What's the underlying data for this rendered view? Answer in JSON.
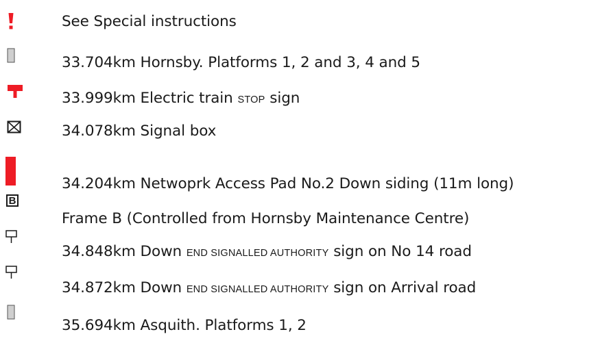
{
  "entries": [
    {
      "icon": "exclamation-icon",
      "text": "See Special instructions"
    },
    {
      "icon": "platform-icon",
      "text": "33.704km Hornsby. Platforms 1, 2 and 3, 4 and 5"
    },
    {
      "icon": "stop-sign-icon",
      "text_before": "33.999km Electric train ",
      "small_caps": "STOP",
      "text_after": " sign"
    },
    {
      "icon": "signal-box-icon",
      "text": "34.078km Signal box"
    },
    {
      "icon": "access-pad-icon",
      "text": "34.204km Netwoprk Access Pad No.2 Down siding (11m long)"
    },
    {
      "icon": "frame-b-icon",
      "icon_letter": "B",
      "text": "Frame B (Controlled from Hornsby Maintenance Centre)"
    },
    {
      "icon": "end-authority-sign-icon",
      "text_before": "34.848km Down ",
      "small_caps": "END SIGNALLED AUTHORITY",
      "text_after": " sign on No 14 road"
    },
    {
      "icon": "end-authority-sign-icon",
      "text_before": "34.872km Down ",
      "small_caps": "END SIGNALLED AUTHORITY",
      "text_after": " sign on Arrival road"
    },
    {
      "icon": "platform-icon",
      "text": "35.694km Asquith. Platforms 1, 2"
    }
  ],
  "colors": {
    "red": "#ee1c25",
    "text": "#1a1a1a",
    "grey_fill": "#cfcfcf",
    "grey_stroke": "#555555"
  }
}
